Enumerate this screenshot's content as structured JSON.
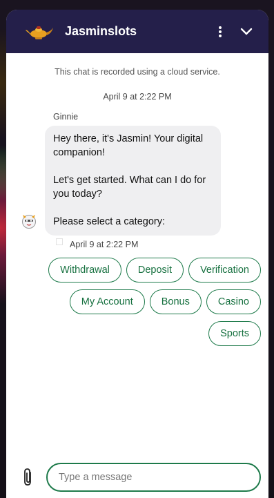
{
  "header": {
    "title": "Jasminslots",
    "logo_icon": "genie-lamp-icon",
    "menu_icon": "kebab-menu-icon",
    "collapse_icon": "chevron-down-icon"
  },
  "chat": {
    "notice": "This chat is recorded using a cloud service.",
    "date_stamp": "April 9 at 2:22 PM",
    "sender": "Ginnie",
    "message_lines": [
      "Hey there, it's Jasmin! Your digital companion!",
      "Let's get started. What can I do for you today?",
      "Please select a category:"
    ],
    "message_time": "April 9 at 2:22 PM"
  },
  "categories": [
    "Withdrawal",
    "Deposit",
    "Verification",
    "My Account",
    "Bonus",
    "Casino",
    "Sports"
  ],
  "composer": {
    "placeholder": "Type a message",
    "attach_icon": "paperclip-icon"
  },
  "colors": {
    "header_bg": "#241f4a",
    "accent": "#1d7a4a",
    "bubble_bg": "#efeff1"
  }
}
